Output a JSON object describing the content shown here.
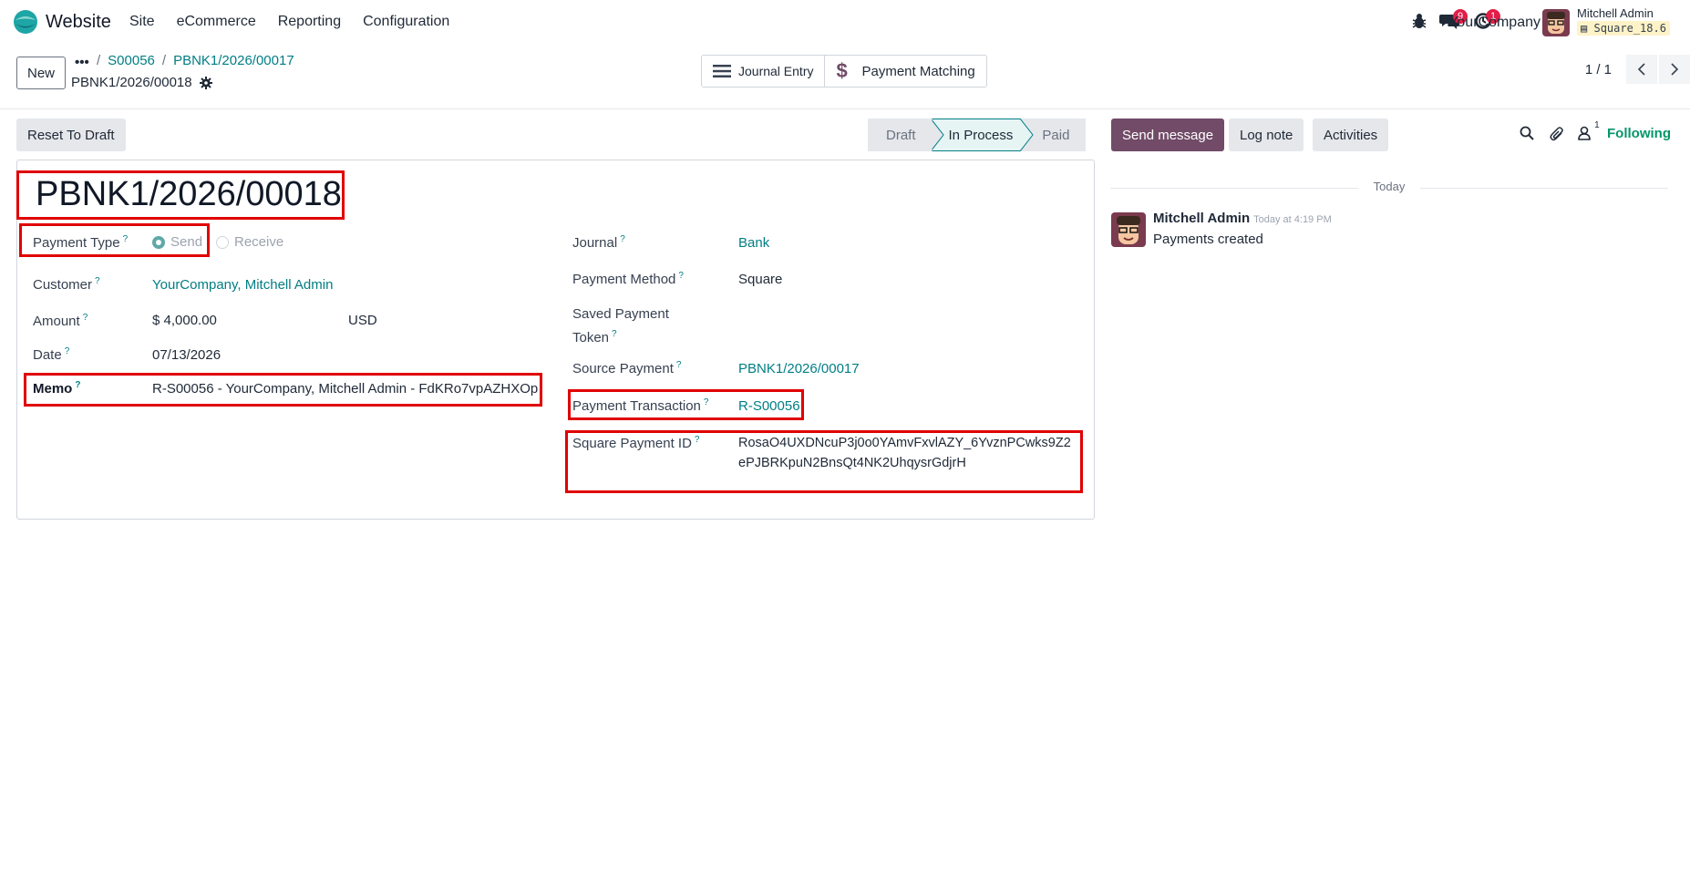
{
  "navbar": {
    "app_name": "Website",
    "menu": [
      "Site",
      "eCommerce",
      "Reporting",
      "Configuration"
    ],
    "messages_badge": "9",
    "activities_badge": "1",
    "company": "YourCompany",
    "user_name": "Mitchell Admin",
    "database": "Square_18.6"
  },
  "control": {
    "new_label": "New",
    "breadcrumb_dots": "•••",
    "breadcrumbs": [
      "S00056",
      "PBNK1/2026/00017"
    ],
    "breadcrumb_separator": "/",
    "current_record": "PBNK1/2026/00018",
    "smart_buttons": {
      "journal_entry": "Journal Entry",
      "payment_matching": "Payment Matching"
    },
    "pager": "1 / 1"
  },
  "statusbar": {
    "reset_label": "Reset To Draft",
    "stages": [
      "Draft",
      "In Process",
      "Paid"
    ],
    "active_stage": "In Process"
  },
  "form": {
    "title": "PBNK1/2026/00018",
    "help_mark": "?",
    "left": {
      "payment_type_label": "Payment Type",
      "payment_type_options": [
        "Send",
        "Receive"
      ],
      "payment_type_selected": "Send",
      "customer_label": "Customer",
      "customer_value": "YourCompany, Mitchell Admin",
      "amount_label": "Amount",
      "amount_value": "$ 4,000.00",
      "currency_value": "USD",
      "date_label": "Date",
      "date_value": "07/13/2026",
      "memo_label": "Memo",
      "memo_value": "R-S00056 - YourCompany, Mitchell Admin - FdKRo7vpAZHXOp"
    },
    "right": {
      "journal_label": "Journal",
      "journal_value": "Bank",
      "payment_method_label": "Payment Method",
      "payment_method_value": "Square",
      "saved_token_label_1": "Saved Payment",
      "saved_token_label_2": "Token",
      "source_payment_label": "Source Payment",
      "source_payment_value": "PBNK1/2026/00017",
      "payment_transaction_label": "Payment Transaction",
      "payment_transaction_value": "R-S00056",
      "square_payment_id_label": "Square Payment ID",
      "square_payment_id_line1": "RosaO4UXDNcuP3j0o0YAmvFxvlAZY_6YvznPCwks9Z2",
      "square_payment_id_line2": "ePJBRKpuN2BnsQt4NK2UhqysrGdjrH"
    }
  },
  "chatter": {
    "send_message": "Send message",
    "log_note": "Log note",
    "activities": "Activities",
    "followers_count": "1",
    "following": "Following",
    "day_separator": "Today",
    "messages": [
      {
        "author": "Mitchell Admin",
        "time": "Today at 4:19 PM",
        "body": "Payments created"
      }
    ]
  },
  "colors": {
    "accent": "#017e84",
    "primary_button": "#714b67",
    "highlight": "#e00000"
  },
  "icons": [
    "bug-icon",
    "chat-icon",
    "clock-icon",
    "gear-icon",
    "hamburger-icon",
    "dollar-icon",
    "chevron-left-icon",
    "chevron-right-icon",
    "search-icon",
    "paperclip-icon",
    "person-icon"
  ]
}
